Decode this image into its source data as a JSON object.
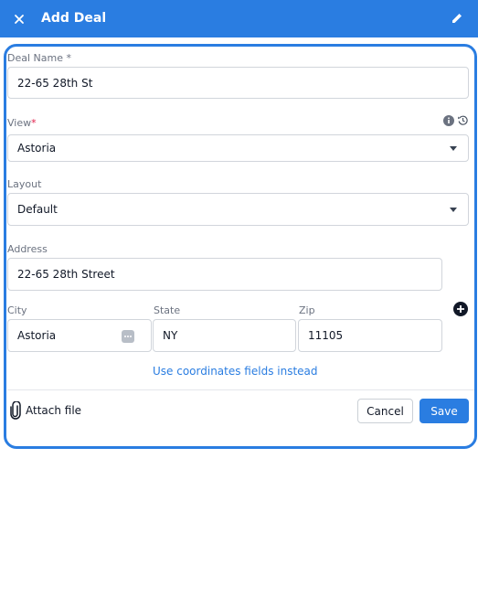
{
  "header": {
    "title": "Add Deal",
    "close_icon": "close-icon",
    "edit_icon": "pencil-icon",
    "bg_color": "#2a7de1"
  },
  "form": {
    "deal_name": {
      "label": "Deal Name *",
      "value": "22-65 28th St"
    },
    "view": {
      "label": "View",
      "required_mark": "*",
      "value": "Astoria"
    },
    "layout": {
      "label": "Layout",
      "value": "Default"
    },
    "address": {
      "label": "Address",
      "value": "22-65 28th Street"
    },
    "city": {
      "label": "City",
      "value": "Astoria"
    },
    "state": {
      "label": "State",
      "value": "NY"
    },
    "zip": {
      "label": "Zip",
      "value": "11105"
    },
    "coordinates_link": "Use coordinates fields instead"
  },
  "footer": {
    "attach_label": "Attach file",
    "cancel_label": "Cancel",
    "save_label": "Save"
  },
  "colors": {
    "accent": "#2a7de1",
    "required": "#e11d48"
  }
}
